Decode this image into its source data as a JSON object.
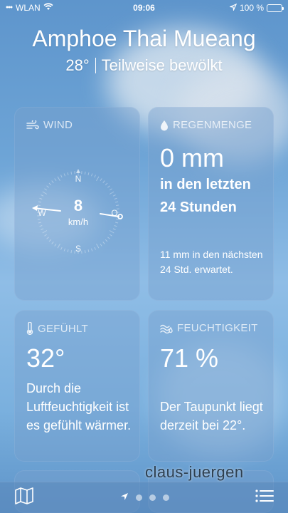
{
  "status_bar": {
    "carrier": "WLAN",
    "time": "09:06",
    "battery": "100 %",
    "battery_level": 1.0
  },
  "header": {
    "city": "Amphoe Thai Mueang",
    "temperature": "28°",
    "condition": "Teilweise bewölkt"
  },
  "wind": {
    "title": "WIND",
    "speed": "8",
    "unit": "km/h",
    "compass": {
      "n": "N",
      "s": "S",
      "w": "W",
      "o": "O"
    },
    "icon": "wind-icon"
  },
  "rain": {
    "title": "REGENMENGE",
    "amount": "0 mm",
    "period": "in den letzten 24 Stunden",
    "forecast": "11 mm in den nächsten 24 Std. erwartet.",
    "icon": "raindrop-icon"
  },
  "feels_like": {
    "title": "GEFÜHLT",
    "value": "32°",
    "description": "Durch die Luftfeuchtigkeit ist es gefühlt wärmer.",
    "icon": "thermometer-icon"
  },
  "humidity": {
    "title": "FEUCHTIGKEIT",
    "value": "71 %",
    "description": "Der Taupunkt liegt derzeit bei 22°.",
    "icon": "humidity-icon"
  },
  "bottom_bar": {
    "map_icon": "map-icon",
    "location_icon": "location-arrow-icon",
    "list_icon": "list-icon",
    "page_count": 3
  },
  "watermark": "claus-juergen"
}
